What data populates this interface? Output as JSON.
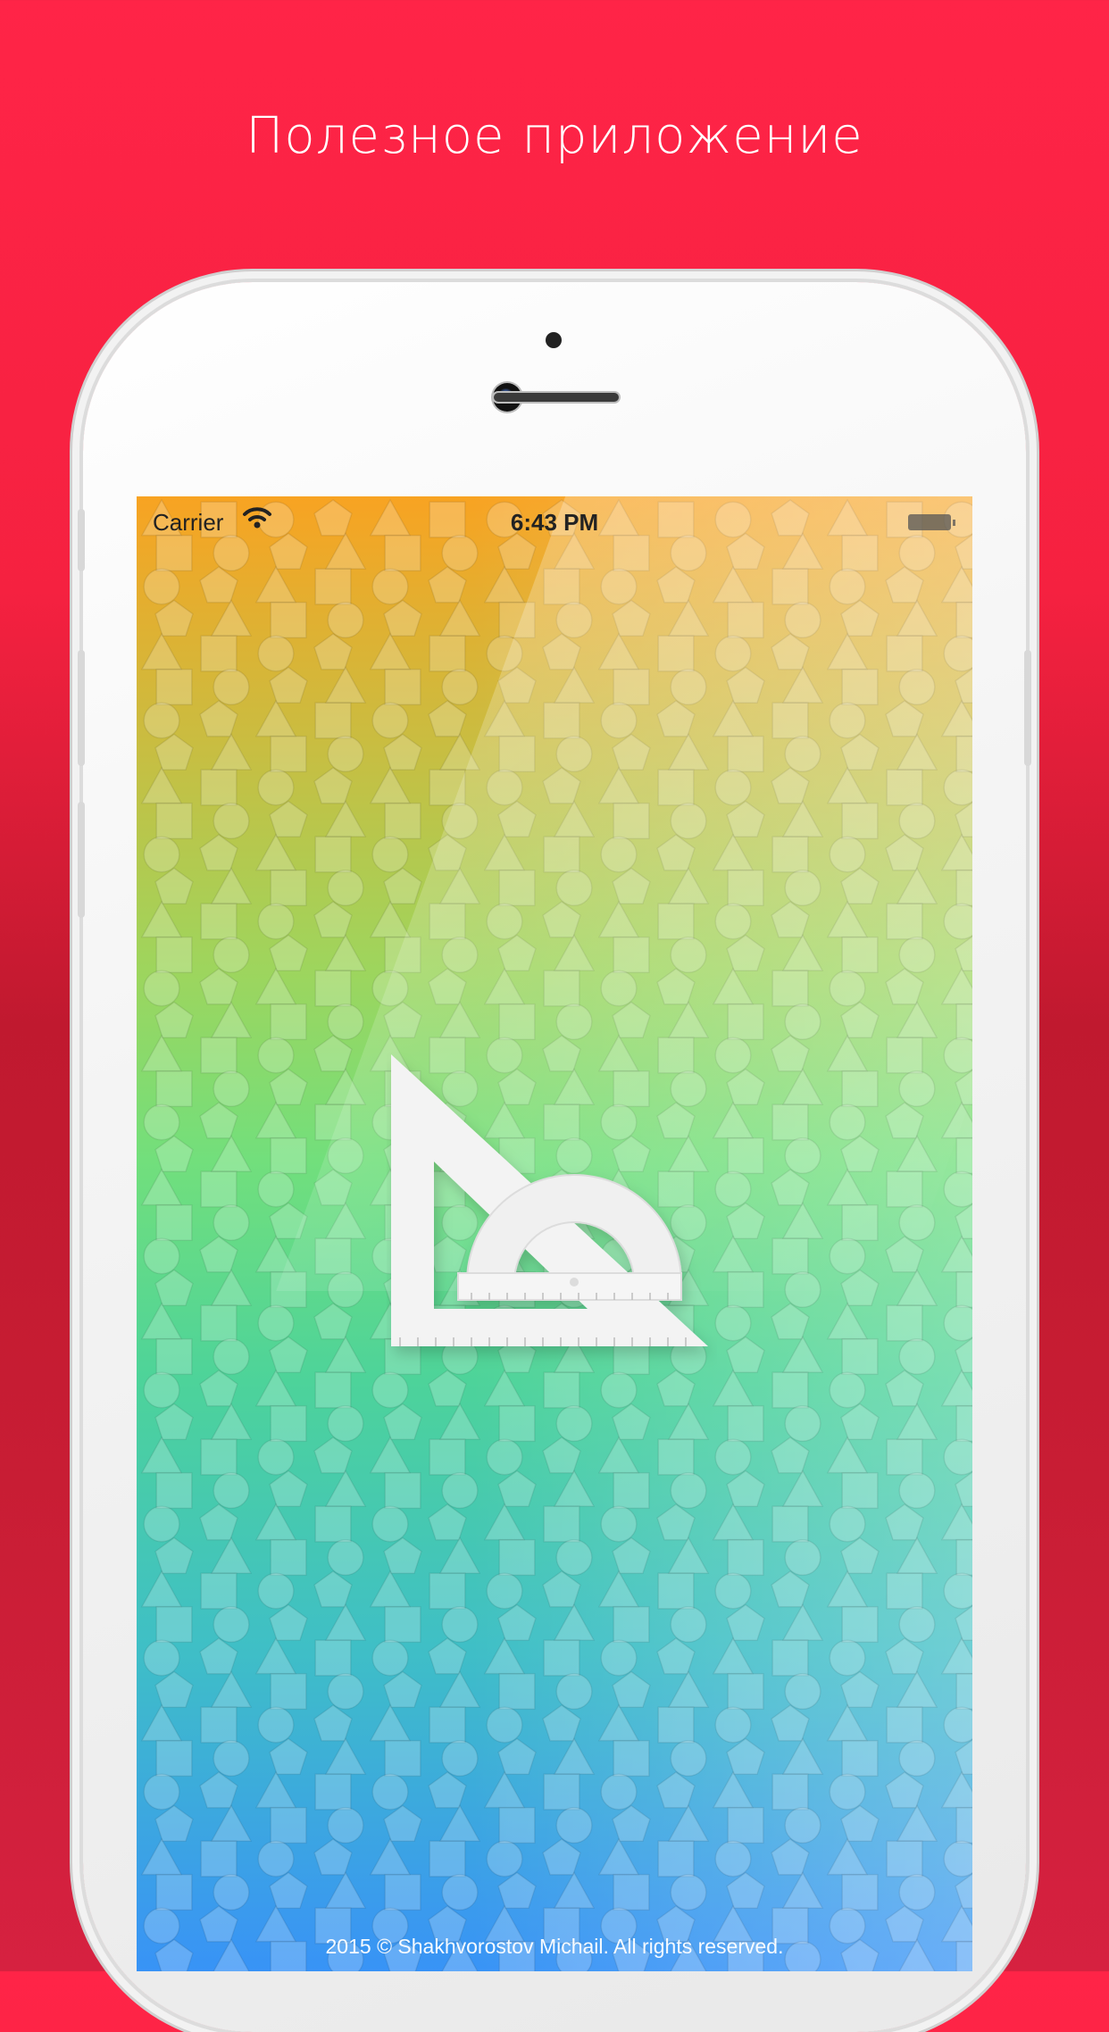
{
  "headline": "Полезное приложение",
  "colors": {
    "background": "#e31e3c",
    "screen_top": "#f8a322",
    "screen_bottom": "#3893f6"
  },
  "status_bar": {
    "carrier": "Carrier",
    "time": "6:43 PM"
  },
  "splash": {
    "logo_icon": "set-square-protractor-icon",
    "background_pattern": "geometric-shapes",
    "footer": "2015 © Shakhvorostov Michail. All rights reserved."
  }
}
